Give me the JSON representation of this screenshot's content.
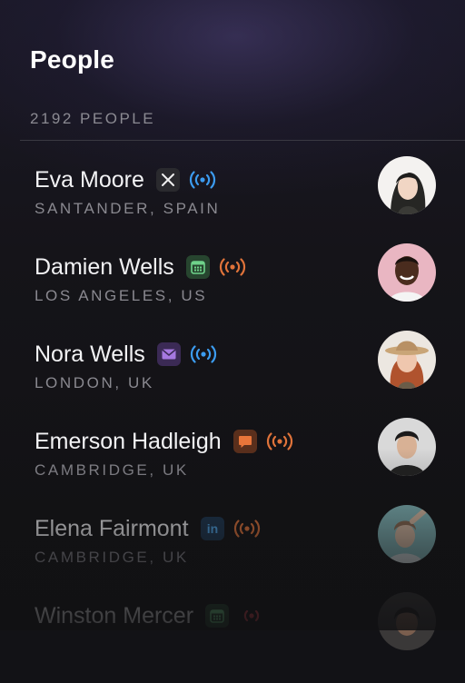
{
  "header": {
    "title": "People",
    "count": "2192 PEOPLE"
  },
  "colors": {
    "live_blue": "#3c9cf0",
    "live_orange": "#e0733a"
  },
  "people": [
    {
      "name": "Eva Moore",
      "location": "SANTANDER, SPAIN",
      "source_icon": "x-logo-icon",
      "status_icon": "broadcast-blue-icon"
    },
    {
      "name": "Damien Wells",
      "location": "LOS ANGELES, US",
      "source_icon": "calendar-icon",
      "status_icon": "broadcast-orange-icon"
    },
    {
      "name": "Nora Wells",
      "location": "LONDON, UK",
      "source_icon": "mail-icon",
      "status_icon": "broadcast-blue-icon"
    },
    {
      "name": "Emerson Hadleigh",
      "location": "CAMBRIDGE, UK",
      "source_icon": "chat-icon",
      "status_icon": "broadcast-orange-icon"
    },
    {
      "name": "Elena Fairmont",
      "location": "CAMBRIDGE, UK",
      "source_icon": "linkedin-icon",
      "status_icon": "broadcast-orange-icon"
    },
    {
      "name": "Winston Mercer",
      "location": "",
      "source_icon": "calendar-icon",
      "status_icon": "broadcast-red-icon"
    }
  ]
}
